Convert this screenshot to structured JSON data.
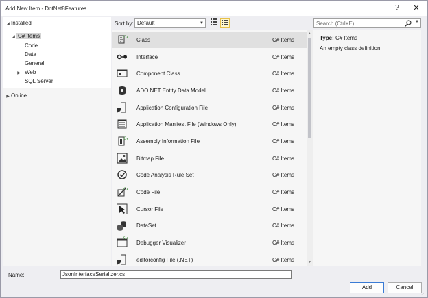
{
  "window": {
    "title": "Add New Item - DotNet8Features",
    "help_label": "?",
    "close_label": "✕"
  },
  "tree": {
    "installed_label": "Installed",
    "root_label": "C# Items",
    "children": [
      "Code",
      "Data",
      "General",
      "Web",
      "SQL Server"
    ],
    "online_label": "Online"
  },
  "toolbar": {
    "sort_label": "Sort by:",
    "sort_value": "Default",
    "search_placeholder": "Search (Ctrl+E)"
  },
  "items": [
    {
      "name": "Class",
      "category": "C# Items",
      "icon": "class-icon"
    },
    {
      "name": "Interface",
      "category": "C# Items",
      "icon": "interface-icon"
    },
    {
      "name": "Component Class",
      "category": "C# Items",
      "icon": "component-class-icon"
    },
    {
      "name": "ADO.NET Entity Data Model",
      "category": "C# Items",
      "icon": "entity-data-model-icon"
    },
    {
      "name": "Application Configuration File",
      "category": "C# Items",
      "icon": "config-file-icon"
    },
    {
      "name": "Application Manifest File (Windows Only)",
      "category": "C# Items",
      "icon": "manifest-file-icon"
    },
    {
      "name": "Assembly Information File",
      "category": "C# Items",
      "icon": "assembly-info-icon"
    },
    {
      "name": "Bitmap File",
      "category": "C# Items",
      "icon": "bitmap-icon"
    },
    {
      "name": "Code Analysis Rule Set",
      "category": "C# Items",
      "icon": "rule-set-icon"
    },
    {
      "name": "Code File",
      "category": "C# Items",
      "icon": "code-file-icon"
    },
    {
      "name": "Cursor File",
      "category": "C# Items",
      "icon": "cursor-file-icon"
    },
    {
      "name": "DataSet",
      "category": "C# Items",
      "icon": "dataset-icon"
    },
    {
      "name": "Debugger Visualizer",
      "category": "C# Items",
      "icon": "debugger-visualizer-icon"
    },
    {
      "name": "editorconfig File (.NET)",
      "category": "C# Items",
      "icon": "editorconfig-icon"
    }
  ],
  "details": {
    "type_label": "Type:",
    "type_value": "C# Items",
    "description": "An empty class definition"
  },
  "footer": {
    "name_label": "Name:",
    "name_value": "JsonInterfaceSerializer.cs",
    "add_label": "Add",
    "cancel_label": "Cancel"
  },
  "colors": {
    "accent": "#3a7bd5",
    "selected_row": "#e0e0e0",
    "csharp_green": "#388a34"
  }
}
